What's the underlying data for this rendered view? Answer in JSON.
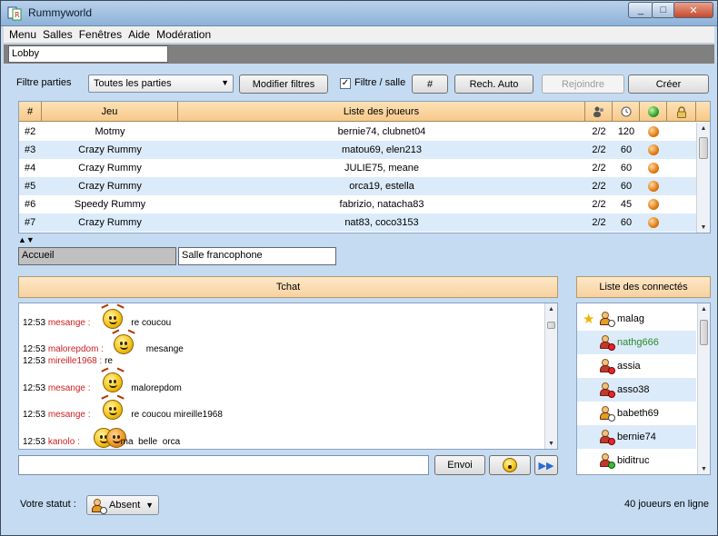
{
  "window": {
    "title": "Rummyworld",
    "min": "_",
    "max": "□",
    "close": "✕"
  },
  "menu": [
    "Menu",
    "Salles",
    "Fenêtres",
    "Aide",
    "Modération"
  ],
  "lobby_tab": "Lobby",
  "filter": {
    "label": "Filtre parties",
    "select_value": "Toutes les parties",
    "modify_button": "Modifier filtres",
    "room_filter_label": "Filtre / salle",
    "room_filter_checked": true,
    "hash_button": "#",
    "auto_search_button": "Rech. Auto",
    "join_button": "Rejoindre",
    "create_button": "Créer"
  },
  "games": {
    "columns": [
      "#",
      "Jeu",
      "Liste des joueurs"
    ],
    "rows": [
      {
        "id": "#2",
        "game": "Motmy",
        "players": "bernie74, clubnet04",
        "seats": "2/2",
        "time": "120"
      },
      {
        "id": "#3",
        "game": "Crazy Rummy",
        "players": "matou69, elen213",
        "seats": "2/2",
        "time": "60"
      },
      {
        "id": "#4",
        "game": "Crazy Rummy",
        "players": "JULIE75, meane",
        "seats": "2/2",
        "time": "60"
      },
      {
        "id": "#5",
        "game": "Crazy Rummy",
        "players": "orca19, estella",
        "seats": "2/2",
        "time": "60"
      },
      {
        "id": "#6",
        "game": "Speedy Rummy",
        "players": "fabrizio, natacha83",
        "seats": "2/2",
        "time": "45"
      },
      {
        "id": "#7",
        "game": "Crazy Rummy",
        "players": "nat83, coco3153",
        "seats": "2/2",
        "time": "60"
      }
    ]
  },
  "room_tabs": [
    "Accueil",
    "Salle francophone"
  ],
  "chat": {
    "header": "Tchat",
    "messages": [
      {
        "time": "12:53",
        "nick": "mesange :",
        "text": "re coucou"
      },
      {
        "time": "12:53",
        "nick": "malorepdom :",
        "text": "mesange"
      },
      {
        "time": "12:53",
        "nick": "mireille1968 :",
        "text": "re"
      },
      {
        "time": "12:53",
        "nick": "mesange :",
        "text": "malorepdom"
      },
      {
        "time": "12:53",
        "nick": "mesange :",
        "text": "re coucou mireille1968"
      },
      {
        "time": "12:53",
        "nick": "kanolo :",
        "text": "ma  belle  orca"
      }
    ],
    "input_value": "",
    "send_button": "Envoi"
  },
  "users": {
    "header": "Liste des connectés",
    "list": [
      {
        "name": "malag",
        "color": "#000000"
      },
      {
        "name": "nathg666",
        "color": "#2a8a2a"
      },
      {
        "name": "assia",
        "color": "#000000"
      },
      {
        "name": "asso38",
        "color": "#000000"
      },
      {
        "name": "babeth69",
        "color": "#000000"
      },
      {
        "name": "bernie74",
        "color": "#000000"
      },
      {
        "name": "biditruc",
        "color": "#000000"
      }
    ]
  },
  "status": {
    "label": "Votre statut :",
    "value": "Absent",
    "online": "40 joueurs en ligne"
  }
}
